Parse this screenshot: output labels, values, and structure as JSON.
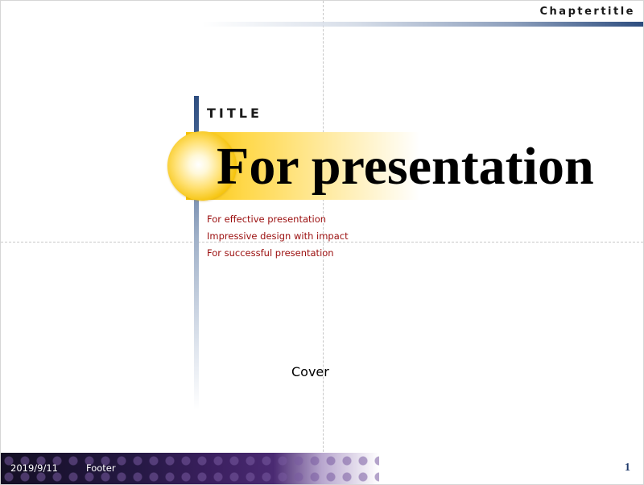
{
  "header": {
    "chapter_title": "Chaptertitle"
  },
  "title_block": {
    "label": "TITLE",
    "main_title": "For presentation",
    "subtitles": [
      "For effective presentation",
      "Impressive design with impact",
      "For successful presentation"
    ]
  },
  "body": {
    "cover_label": "Cover"
  },
  "footer": {
    "date": "2019/9/11",
    "text": "Footer",
    "page_number": "1"
  },
  "colors": {
    "accent_blue": "#2d4d7f",
    "gold": "#f6c200",
    "subtitle_red": "#9a0d0d",
    "page_number_blue": "#1f3a6b"
  }
}
